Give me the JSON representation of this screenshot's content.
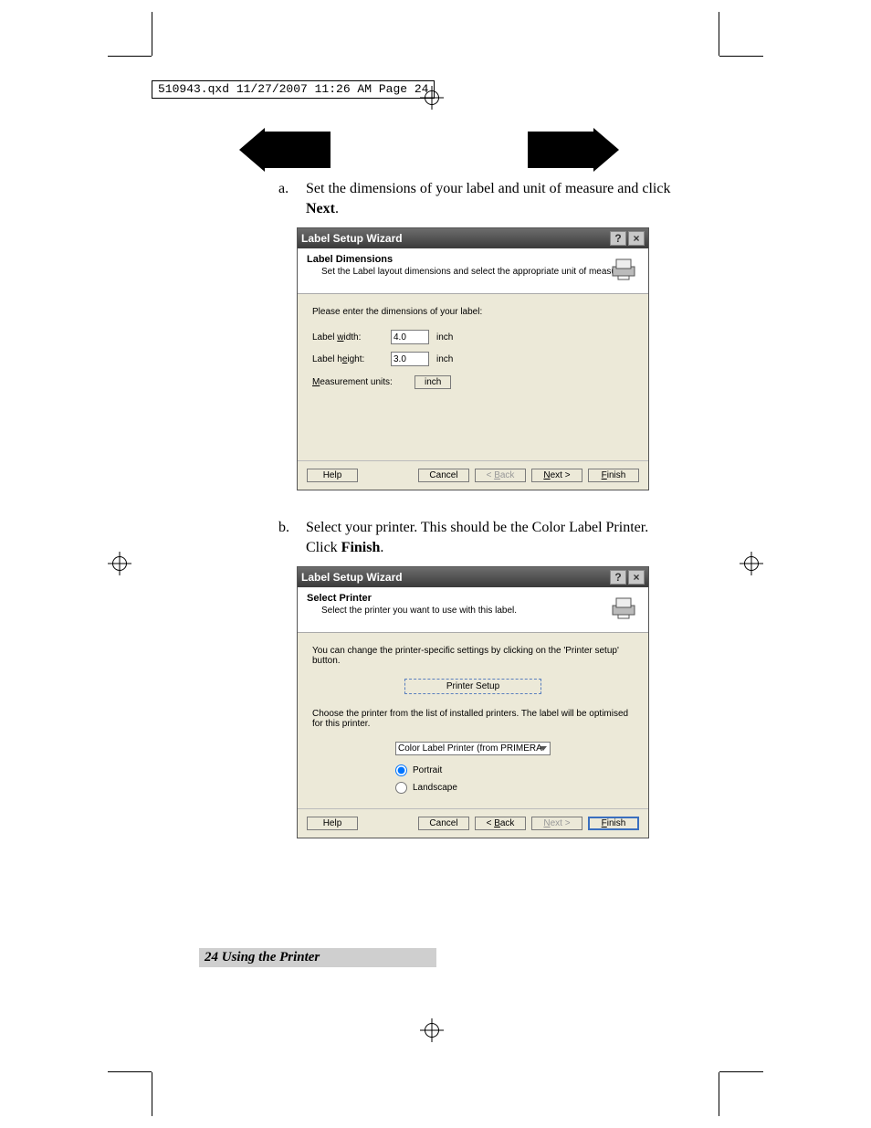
{
  "slug": "510943.qxd  11/27/2007  11:26 AM  Page 24",
  "steps": {
    "a": {
      "letter": "a.",
      "text_before": "Set the dimensions of your label and unit of measure and click ",
      "text_bold": "Next",
      "text_after": "."
    },
    "b": {
      "letter": "b.",
      "text_before": "Select your printer.  This should be the Color Label Printer.  Click ",
      "text_bold": "Finish",
      "text_after": "."
    }
  },
  "dialog1": {
    "title": "Label Setup Wizard",
    "header_title": "Label Dimensions",
    "header_sub": "Set the Label layout dimensions and select the appropriate unit of measure.",
    "intro": "Please enter the dimensions of your label:",
    "width_label": "Label width:",
    "width_value": "4.0",
    "width_unit": "inch",
    "height_label": "Label height:",
    "height_value": "3.0",
    "height_unit": "inch",
    "units_label": "Measurement units:",
    "units_value": "inch",
    "buttons": {
      "help": "Help",
      "cancel": "Cancel",
      "back": "< Back",
      "next": "Next >",
      "finish": "Finish"
    }
  },
  "dialog2": {
    "title": "Label Setup Wizard",
    "header_title": "Select Printer",
    "header_sub": "Select the printer you want to use with this label.",
    "instr1": "You can change the printer-specific settings by clicking on the 'Printer setup' button.",
    "printer_setup": "Printer Setup",
    "instr2": "Choose the printer from the list of installed printers. The label will be optimised for this printer.",
    "printer_selected": "Color Label Printer (from PRIMERA-",
    "portrait": "Portrait",
    "landscape": "Landscape",
    "buttons": {
      "help": "Help",
      "cancel": "Cancel",
      "back": "< Back",
      "next": "Next >",
      "finish": "Finish"
    }
  },
  "footer": {
    "page": "24",
    "section": "Using the Printer"
  }
}
